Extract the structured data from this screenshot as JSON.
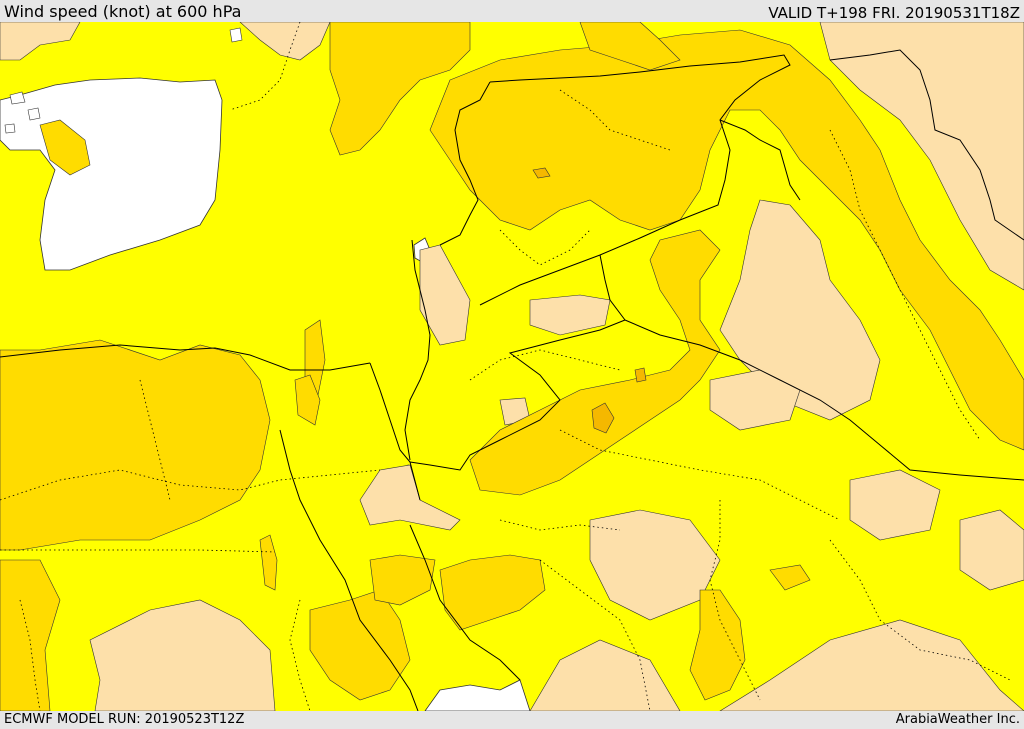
{
  "header": {
    "title": "Wind speed (knot) at 600 hPa",
    "valid": "VALID T+198 FRI. 20190531T18Z"
  },
  "footer": {
    "model_run": "ECMWF MODEL RUN: 20190523T12Z",
    "credit": "ArabiaWeather Inc."
  },
  "colors": {
    "sea": "#ffffff",
    "band_low": "#fde0aa",
    "band_mid": "#ffff00",
    "band_high": "#ffdc00",
    "band_peak": "#f5b800",
    "border": "#000000",
    "bar": "#e6e6e6"
  }
}
